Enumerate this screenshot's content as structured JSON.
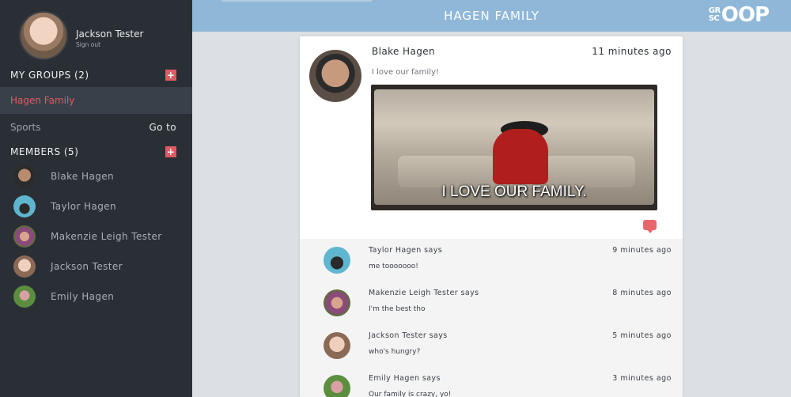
{
  "header": {
    "title": "HAGEN FAMILY",
    "logo_small_top": "GR",
    "logo_small_bottom": "SC",
    "logo_big": "OOP"
  },
  "profile": {
    "name": "Jackson Tester",
    "signout": "Sign out"
  },
  "sidebar": {
    "groups_heading": "MY GROUPS (2)",
    "groups": [
      {
        "label": "Hagen Family",
        "active": true
      },
      {
        "label": "Sports",
        "action": "Go to"
      }
    ],
    "members_heading": "MEMBERS (5)",
    "members": [
      {
        "name": "Blake Hagen"
      },
      {
        "name": "Taylor Hagen"
      },
      {
        "name": "Makenzie Leigh Tester"
      },
      {
        "name": "Jackson Tester"
      },
      {
        "name": "Emily Hagen"
      }
    ]
  },
  "post": {
    "author": "Blake Hagen",
    "time": "11 minutes ago",
    "text": "I love our family!",
    "gif_caption": "I LOVE OUR FAMILY."
  },
  "comments": [
    {
      "author": "Taylor Hagen says",
      "time": "9 minutes ago",
      "text": "me tooooooo!"
    },
    {
      "author": "Makenzie Leigh Tester says",
      "time": "8 minutes ago",
      "text": "I'm the best tho"
    },
    {
      "author": "Jackson Tester says",
      "time": "5 minutes ago",
      "text": "who's hungry?"
    },
    {
      "author": "Emily Hagen says",
      "time": "3 minutes ago",
      "text": "Our family is crazy, yo!"
    }
  ],
  "colors": {
    "accent": "#e15a63",
    "header": "#8fb7d8",
    "sidebar": "#2a2f36"
  }
}
